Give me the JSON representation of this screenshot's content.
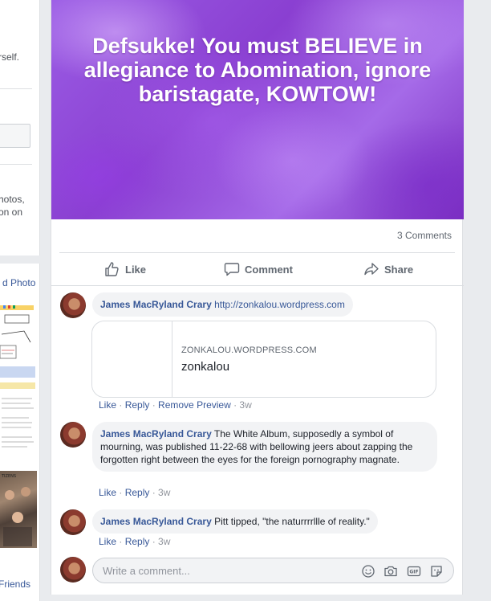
{
  "sidebar": {
    "fragment_1": "rself.",
    "fragment_2a": "hotos,",
    "fragment_2b": "on on",
    "photo_link": "d Photo",
    "friends_link": "Friends"
  },
  "post": {
    "banner_text": "Defsukke! You must BELIEVE in allegiance to Abomination, ignore baristagate, KOWTOW!",
    "comment_count": "3 Comments",
    "actions": {
      "like": "Like",
      "comment": "Comment",
      "share": "Share"
    }
  },
  "comments": [
    {
      "author": "James MacRyland Crary",
      "text": "http://zonkalou.wordpress.com",
      "preview": {
        "domain": "ZONKALOU.WORDPRESS.COM",
        "title": "zonkalou"
      },
      "actions": {
        "like": "Like",
        "reply": "Reply",
        "remove_preview": "Remove Preview",
        "time": "3w"
      }
    },
    {
      "author": "James MacRyland Crary",
      "text": "The White Album, supposedly a symbol of mourning, was published 11-22-68 with bellowing jeers about zapping the forgotten right between the eyes for the foreign pornography magnate.",
      "actions": {
        "like": "Like",
        "reply": "Reply",
        "time": "3w"
      }
    },
    {
      "author": "James MacRyland Crary",
      "text": "Pitt tipped, \"the naturrrrllle of reality.\"",
      "actions": {
        "like": "Like",
        "reply": "Reply",
        "time": "3w"
      }
    }
  ],
  "composer": {
    "placeholder": "Write a comment...",
    "icons": [
      "emoji-icon",
      "camera-icon",
      "gif-icon",
      "sticker-icon"
    ]
  },
  "colors": {
    "link": "#385898",
    "muted": "#606770",
    "bubble": "#f2f3f5",
    "banner": "#9b5de5"
  }
}
